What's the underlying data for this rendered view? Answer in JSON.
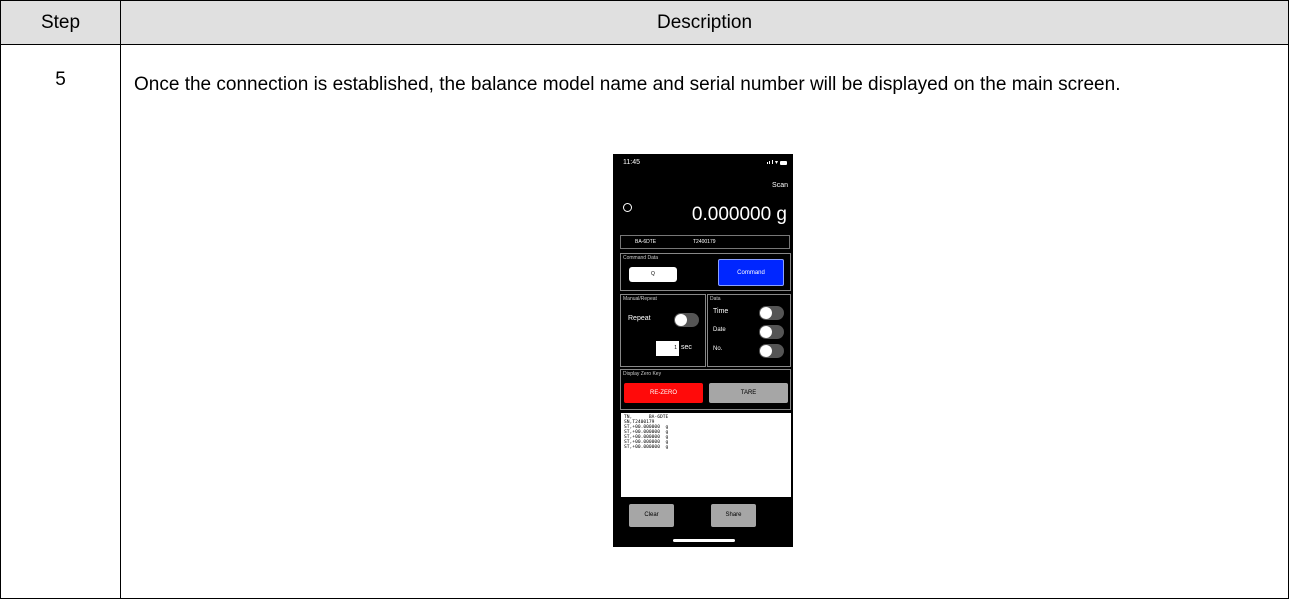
{
  "table": {
    "headers": {
      "step": "Step",
      "description": "Description"
    },
    "rows": [
      {
        "step": "5",
        "description": "Once the connection is established, the balance model name and serial number will be displayed on the main screen."
      }
    ]
  },
  "phone": {
    "status_time": "11:45",
    "scan_label": "Scan",
    "weight": "0.000000 g",
    "model": "BA-6DTE",
    "serial": "T2400179",
    "command_panel_label": "Command Data",
    "command_input_value": "Q",
    "command_button": "Command",
    "manual_repeat_label": "Manual/Repeat",
    "repeat_label": "Repeat",
    "interval_value": "1",
    "interval_unit": "sec",
    "data_panel_label": "Data",
    "time_label": "Time",
    "date_label": "Date",
    "no_label": "No.",
    "zero_panel_label": "Display Zero Key",
    "rezero_button": "RE-ZERO",
    "tare_button": "TARE",
    "log_lines": [
      "TN,      BA-6DTE",
      "SN,T2400179",
      "ST,+00.000000  g",
      "ST,+00.000000  g",
      "ST,+00.000000  g",
      "ST,+00.000000  g",
      "ST,+00.000000  g"
    ],
    "clear_button": "Clear",
    "share_button": "Share",
    "colors": {
      "command": "#0026ff",
      "rezero": "#ff0a0a",
      "secondary_button": "#a6a6a6"
    }
  }
}
